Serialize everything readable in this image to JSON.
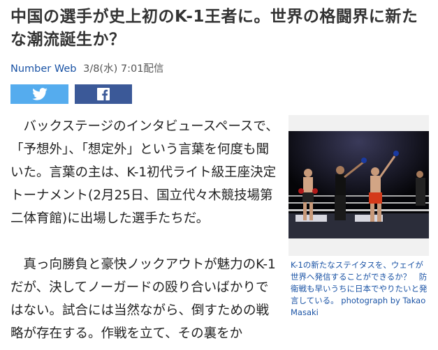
{
  "article": {
    "title": "中国の選手が史上初のK-1王者に。世界の格闘界に新たな潮流誕生か？",
    "source": "Number Web",
    "datetime": "3/8(水) 7:01配信",
    "body": [
      "　バックステージのインタビュースペースで、「予想外」、「想定外」という言葉を何度も聞いた。言葉の主は、K-1初代ライト級王座決定トーナメント(2月25日、国立代々木競技場第二体育館)に出場した選手たちだ。",
      "　真っ向勝負と豪快ノックアウトが魅力のK-1だが、決してノーガードの殴り合いばかりではない。試合には当然ながら、倒すための戦略が存在する。作戦を立て、その裏をか"
    ]
  },
  "share": {
    "twitter_icon": "twitter-icon",
    "facebook_icon": "facebook-icon",
    "twitter_color": "#55acee",
    "facebook_color": "#3b5998"
  },
  "figure": {
    "caption": "K-1の新たなステイタスを、ウェイが世界へ発信することができるか？　防衛戦も早いうちに日本でやりたいと発言している。 photograph by Takao Masaki"
  },
  "colors": {
    "link": "#1a53a5",
    "title": "#333333"
  }
}
